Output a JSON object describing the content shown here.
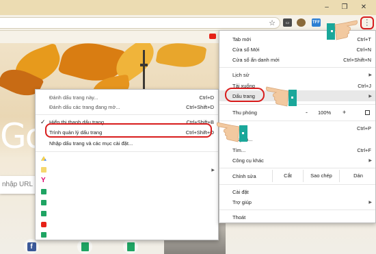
{
  "window": {
    "minimize": "–",
    "restore": "❐",
    "close": "✕"
  },
  "toolbar": {
    "star_icon": "star-icon",
    "menu_icon": "three-dots-icon",
    "ext_label": "TFF"
  },
  "bookmarks_menu": {
    "items": [
      {
        "label": "Đánh dấu trang này...",
        "shortcut": "Ctrl+D"
      },
      {
        "label": "Đánh dấu các trang đang mở...",
        "shortcut": "Ctrl+Shift+D"
      },
      {
        "label": "Hiển thị thanh dấu trang",
        "shortcut": "Ctrl+Shift+B",
        "checked": "✓"
      },
      {
        "label": "Trình quản lý dấu trang",
        "shortcut": "Ctrl+Shift+O"
      },
      {
        "label": "Nhập dấu trang và các mục cài đặt..."
      }
    ]
  },
  "chrome_menu": {
    "new_tab": {
      "label": "Tab mới",
      "shortcut": "Ctrl+T"
    },
    "new_window": {
      "label": "Cửa sổ Mới",
      "shortcut": "Ctrl+N"
    },
    "incognito": {
      "label": "Cửa sổ ẩn danh mới",
      "shortcut": "Ctrl+Shift+N"
    },
    "history": {
      "label": "Lịch sử"
    },
    "downloads": {
      "label": "Tải xuống",
      "shortcut": "Ctrl+J"
    },
    "bookmarks": {
      "label": "Dấu trang"
    },
    "zoom": {
      "label": "Thu phóng",
      "minus": "-",
      "value": "100%",
      "plus": "+"
    },
    "print": {
      "label": "In...",
      "shortcut": "Ctrl+P"
    },
    "cast": {
      "label": "Truyền..."
    },
    "find": {
      "label": "Tìm...",
      "shortcut": "Ctrl+F"
    },
    "more_tools": {
      "label": "Công cụ khác"
    },
    "edit": {
      "label": "Chỉnh sửa",
      "cut": "Cắt",
      "copy": "Sao chép",
      "paste": "Dán"
    },
    "settings": {
      "label": "Cài đặt"
    },
    "help": {
      "label": "Trợ giúp"
    },
    "exit": {
      "label": "Thoát"
    }
  },
  "page": {
    "logo_partial": "Go",
    "search_placeholder": "nhập URL"
  },
  "colors": {
    "highlight": "#d81c1c",
    "accent_teal": "#1aa79a"
  }
}
